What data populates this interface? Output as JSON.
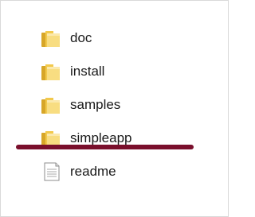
{
  "files": [
    {
      "name": "doc",
      "icon": "folder-icon"
    },
    {
      "name": "install",
      "icon": "folder-icon"
    },
    {
      "name": "samples",
      "icon": "folder-icon"
    },
    {
      "name": "simpleapp",
      "icon": "folder-icon"
    },
    {
      "name": "readme",
      "icon": "text-file-icon"
    }
  ],
  "colors": {
    "folder_light": "#f8dd81",
    "folder_dark": "#d7a628",
    "underline": "#7a0f2c"
  }
}
